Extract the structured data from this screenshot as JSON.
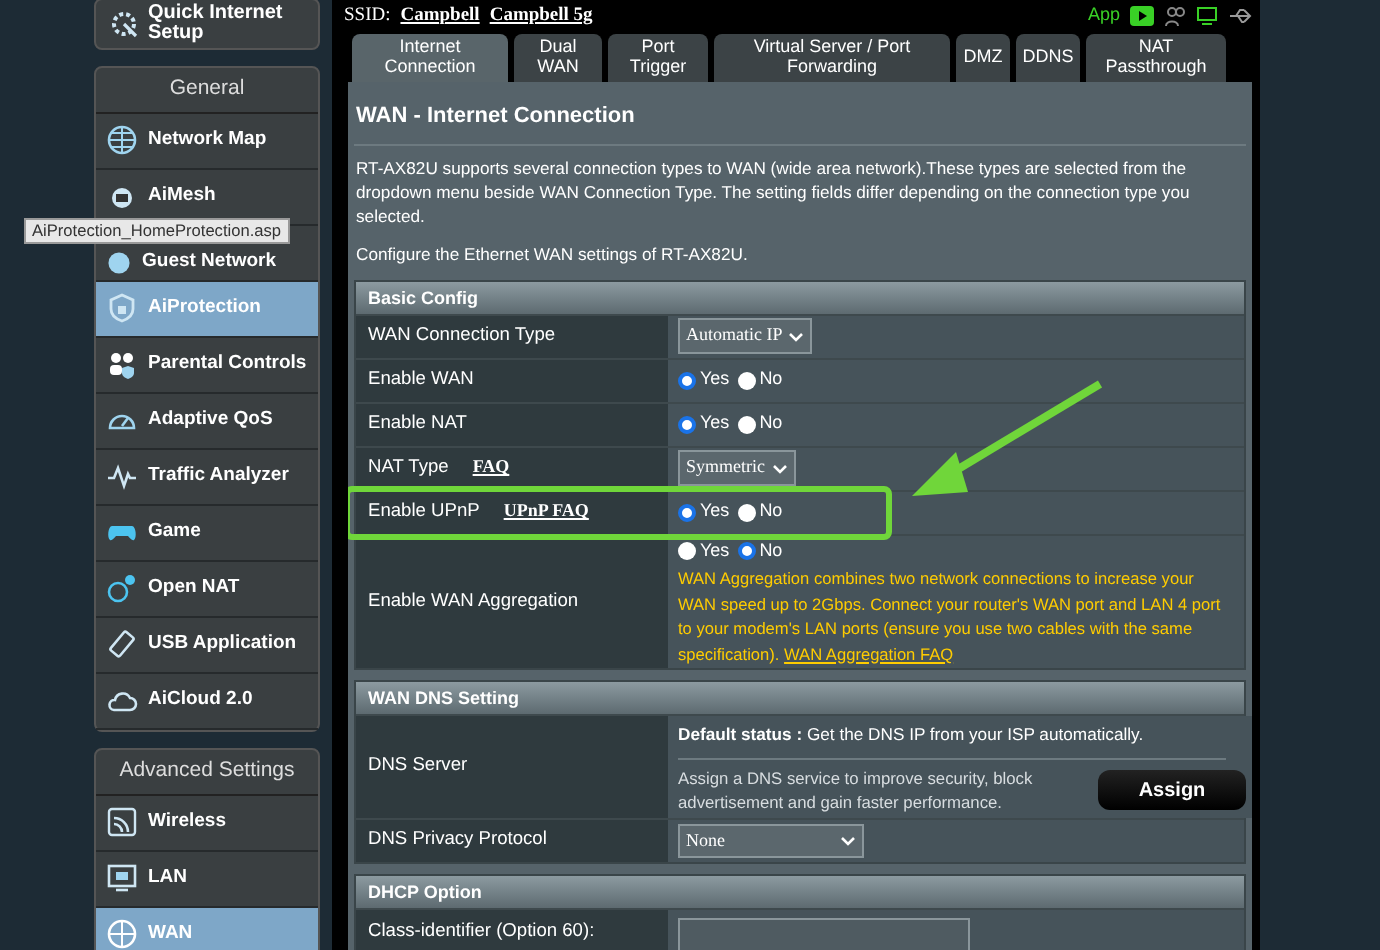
{
  "sidebar": {
    "quick_setup": "Quick Internet Setup",
    "groups": [
      {
        "title": "General",
        "items": [
          {
            "label": "Network Map",
            "selected": false
          },
          {
            "label": "AiMesh",
            "selected": false
          },
          {
            "label": "Guest Network",
            "selected": false
          },
          {
            "label": "AiProtection",
            "selected": true
          },
          {
            "label": "Parental Controls",
            "selected": false
          },
          {
            "label": "Adaptive QoS",
            "selected": false
          },
          {
            "label": "Traffic Analyzer",
            "selected": false
          },
          {
            "label": "Game",
            "selected": false
          },
          {
            "label": "Open NAT",
            "selected": false
          },
          {
            "label": "USB Application",
            "selected": false
          },
          {
            "label": "AiCloud 2.0",
            "selected": false
          }
        ]
      },
      {
        "title": "Advanced Settings",
        "items": [
          {
            "label": "Wireless",
            "selected": false
          },
          {
            "label": "LAN",
            "selected": false
          },
          {
            "label": "WAN",
            "selected": true
          }
        ]
      }
    ],
    "tooltip": "AiProtection_HomeProtection.asp"
  },
  "top_bar": {
    "ssid_label": "SSID:",
    "ssids": [
      "Campbell",
      "Campbell 5g"
    ],
    "app_label": "App"
  },
  "tabs": [
    {
      "label": "Internet Connection",
      "selected": true
    },
    {
      "label": "Dual WAN",
      "selected": false
    },
    {
      "label": "Port Trigger",
      "selected": false
    },
    {
      "label": "Virtual Server / Port Forwarding",
      "selected": false
    },
    {
      "label": "DMZ",
      "selected": false
    },
    {
      "label": "DDNS",
      "selected": false
    },
    {
      "label": "NAT Passthrough",
      "selected": false
    }
  ],
  "page": {
    "title": "WAN - Internet Connection",
    "description": "RT-AX82U supports several connection types to WAN (wide area network).These types are selected from the dropdown menu beside WAN Connection Type. The setting fields differ depending on the connection type you selected.",
    "note": "Configure the Ethernet WAN settings of RT-AX82U."
  },
  "sections": [
    {
      "title": "Basic Config",
      "rows": [
        {
          "label": "WAN Connection Type",
          "kind": "select",
          "value": "Automatic IP",
          "highlighted": false
        },
        {
          "label": "Enable WAN",
          "kind": "radio",
          "options": [
            {
              "label": "Yes",
              "selected": true
            },
            {
              "label": "No",
              "selected": false
            }
          ],
          "highlighted": false
        },
        {
          "label": "Enable NAT",
          "kind": "radio",
          "options": [
            {
              "label": "Yes",
              "selected": true
            },
            {
              "label": "No",
              "selected": false
            }
          ],
          "highlighted": false
        },
        {
          "label": "NAT Type",
          "link": "FAQ",
          "kind": "select",
          "value": "Symmetric",
          "highlighted": false
        },
        {
          "label": "Enable UPnP",
          "link": "UPnP FAQ",
          "kind": "radio",
          "options": [
            {
              "label": "Yes",
              "selected": true
            },
            {
              "label": "No",
              "selected": false
            }
          ],
          "highlighted": true
        },
        {
          "label": "Enable WAN Aggregation",
          "kind": "radio",
          "options": [
            {
              "label": "Yes",
              "selected": false
            },
            {
              "label": "No",
              "selected": true
            }
          ],
          "note": "WAN Aggregation combines two network connections to increase your WAN speed up to 2Gbps. Connect your router's WAN port and LAN 4 port to your modem's LAN ports (ensure you use two cables with the same specification).",
          "note_link": "WAN Aggregation FAQ",
          "highlighted": false
        }
      ]
    },
    {
      "title": "WAN DNS Setting",
      "rows": [
        {
          "label": "DNS Server",
          "kind": "dns",
          "status": "**Default status :** Get the DNS IP from your ISP automatically.",
          "hint": "Assign a DNS service to improve security, block advertisement and gain faster performance.",
          "button": "Assign",
          "highlighted": false
        },
        {
          "label": "DNS Privacy Protocol",
          "kind": "select",
          "value": "None",
          "wide": true,
          "highlighted": false
        }
      ]
    },
    {
      "title": "DHCP Option",
      "rows": [
        {
          "label": "Class-identifier (Option 60):",
          "kind": "text",
          "highlighted": false
        }
      ]
    }
  ]
}
